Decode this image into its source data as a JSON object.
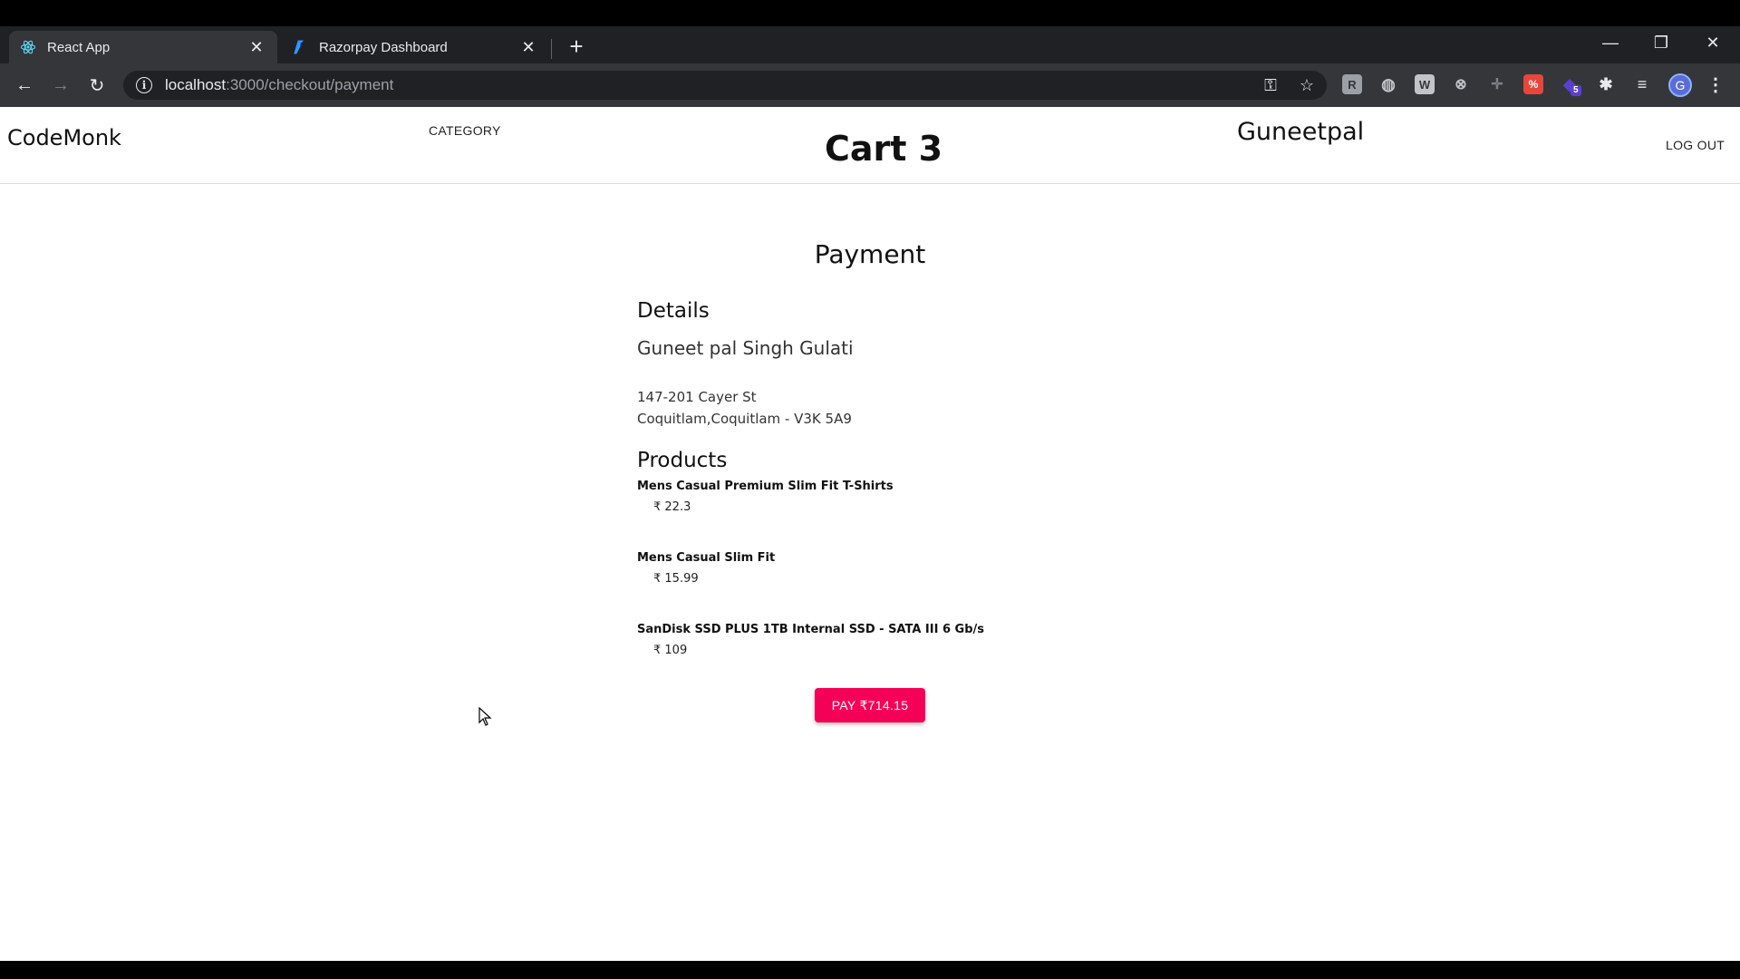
{
  "browser": {
    "tabs": [
      {
        "title": "React App",
        "active": true,
        "icon": "react-icon"
      },
      {
        "title": "Razorpay Dashboard",
        "active": false,
        "icon": "razorpay-icon"
      }
    ],
    "new_tab": "+",
    "url_host": "localhost",
    "url_path": ":3000/checkout/payment",
    "profile_initial": "G",
    "extension_badge": "5"
  },
  "header": {
    "brand": "CodeMonk",
    "category": "CATEGORY",
    "cart": "Cart 3",
    "username": "Guneetpal",
    "logout": "LOG OUT"
  },
  "payment": {
    "title": "Payment",
    "details_title": "Details",
    "customer_name": "Guneet pal Singh Gulati",
    "address_line1": "147-201 Cayer St",
    "address_line2": "Coquitlam,Coquitlam - V3K 5A9",
    "products_title": "Products",
    "products": [
      {
        "name": "Mens Casual Premium Slim Fit T-Shirts",
        "price": "₹ 22.3"
      },
      {
        "name": "Mens Casual Slim Fit",
        "price": "₹ 15.99"
      },
      {
        "name": "SanDisk SSD PLUS 1TB Internal SSD - SATA III 6 Gb/s",
        "price": "₹ 109"
      }
    ],
    "pay_button": "PAY ₹714.15"
  },
  "colors": {
    "accent": "#f50057",
    "chrome_dark": "#202124",
    "chrome_tab": "#35363a"
  }
}
